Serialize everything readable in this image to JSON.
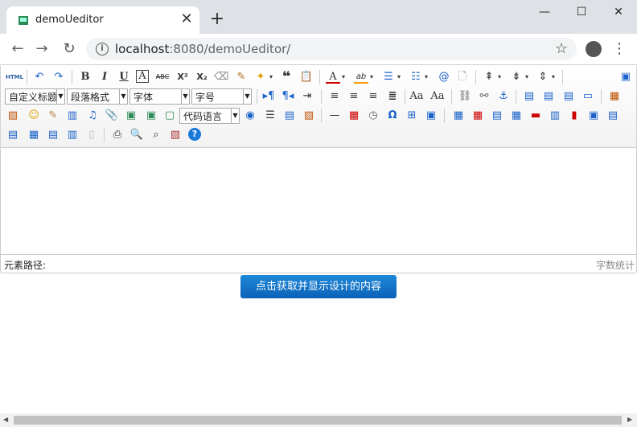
{
  "tab": {
    "title": "demoUeditor",
    "close": "✕",
    "new_tab": "+"
  },
  "window": {
    "minimize": "—",
    "maximize": "☐",
    "close": "✕"
  },
  "nav": {
    "url_host": "localhost",
    "url_rest": ":8080/demoUeditor/"
  },
  "toolbar": {
    "html": "HTML",
    "bold": "B",
    "italic": "I",
    "underline": "U",
    "fontborder": "A",
    "strike": "ABC",
    "superscript": "X²",
    "subscript": "X₂",
    "quote": "❝",
    "forecolor": "A",
    "backcolor": "ab",
    "combos": {
      "customstyle": "自定义标题",
      "paragraph": "段落格式",
      "fontfamily": "字体",
      "fontsize": "字号",
      "code": "代码语言"
    },
    "omega": "Ω"
  },
  "status": {
    "path_label": "元素路径:",
    "wordcount": "字数统计"
  },
  "action_button": "点击获取并显示设计的内容"
}
